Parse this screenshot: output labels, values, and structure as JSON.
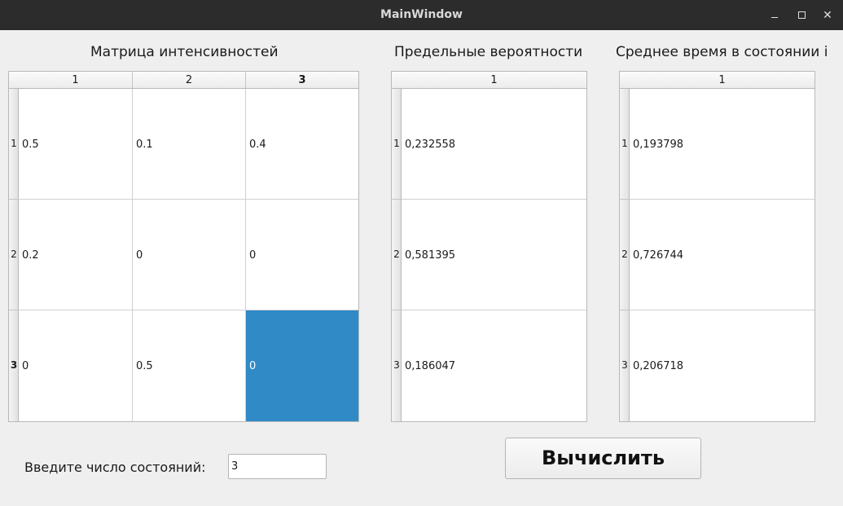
{
  "window": {
    "title": "MainWindow",
    "minimize_glyph": "–",
    "close_glyph": "✕"
  },
  "headings": {
    "matrix": "Матрица интенсивностей",
    "limits": "Предельные вероятности",
    "mean_time": "Среднее время в состоянии i"
  },
  "matrix_table": {
    "columns": [
      "1",
      "2",
      "3"
    ],
    "rows": [
      "1",
      "2",
      "3"
    ],
    "cells": [
      [
        "0.5",
        "0.1",
        "0.4"
      ],
      [
        "0.2",
        "0",
        "0"
      ],
      [
        "0",
        "0.5",
        "0"
      ]
    ],
    "selected_cell": [
      2,
      2
    ]
  },
  "limits_table": {
    "columns": [
      "1"
    ],
    "rows": [
      "1",
      "2",
      "3"
    ],
    "cells": [
      [
        "0,232558"
      ],
      [
        "0,581395"
      ],
      [
        "0,186047"
      ]
    ]
  },
  "mean_time_table": {
    "columns": [
      "1"
    ],
    "rows": [
      "1",
      "2",
      "3"
    ],
    "cells": [
      [
        "0,193798"
      ],
      [
        "0,726744"
      ],
      [
        "0,206718"
      ]
    ]
  },
  "states": {
    "label": "Введите число состояний:",
    "value": "3"
  },
  "actions": {
    "calculate_label": "Вычислить"
  },
  "colors": {
    "selection": "#2f8ac6",
    "titlebar": "#2c2c2c",
    "window_bg": "#efefef"
  }
}
